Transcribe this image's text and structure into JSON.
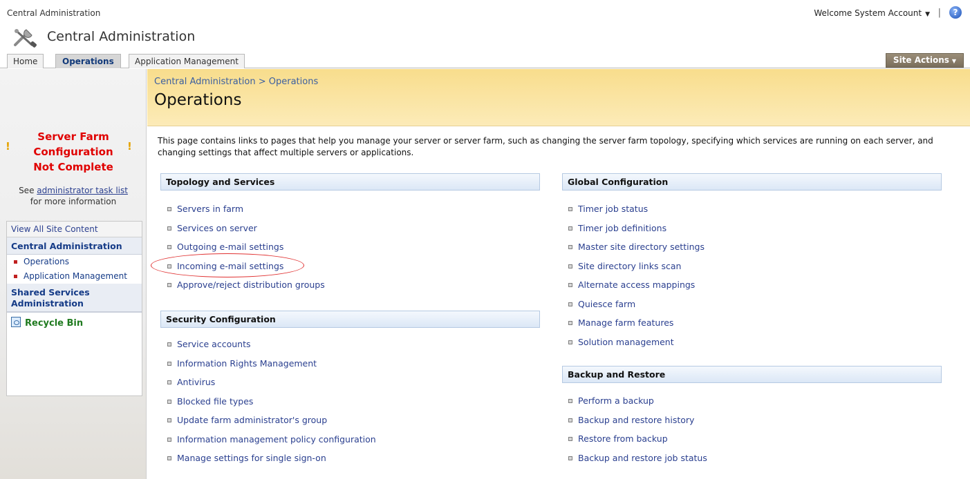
{
  "topbar": {
    "site_name": "Central Administration",
    "welcome": "Welcome System Account",
    "separator": "|"
  },
  "header": {
    "site_title": "Central Administration"
  },
  "tabs": [
    {
      "label": "Home"
    },
    {
      "label": "Operations",
      "selected": true
    },
    {
      "label": "Application Management"
    }
  ],
  "site_actions": "Site Actions",
  "sidebar": {
    "warning_lines": [
      "Server Farm",
      "Configuration",
      "Not Complete"
    ],
    "see_prefix": "See ",
    "task_list_link": "administrator task list",
    "see_suffix": "for more information",
    "quick_launch": {
      "view_all": "View All Site Content",
      "central_admin_heading": "Central Administration",
      "items": [
        {
          "label": "Operations"
        },
        {
          "label": "Application Management"
        }
      ],
      "shared_services_heading": "Shared Services Administration",
      "recycle_bin": "Recycle Bin"
    }
  },
  "main": {
    "breadcrumb": "Central Administration > Operations",
    "title": "Operations",
    "intro": "This page contains links to pages that help you manage your server or server farm, such as changing the server farm topology, specifying which services are running on each server, and changing settings that affect multiple servers or applications.",
    "sections": {
      "topology": {
        "heading": "Topology and Services",
        "links": [
          "Servers in farm",
          "Services on server",
          "Outgoing e-mail settings",
          "Incoming e-mail settings",
          "Approve/reject distribution groups"
        ]
      },
      "security": {
        "heading": "Security Configuration",
        "links": [
          "Service accounts",
          "Information Rights Management",
          "Antivirus",
          "Blocked file types",
          "Update farm administrator's group",
          "Information management policy configuration",
          "Manage settings for single sign-on"
        ]
      },
      "global": {
        "heading": "Global Configuration",
        "links": [
          "Timer job status",
          "Timer job definitions",
          "Master site directory settings",
          "Site directory links scan",
          "Alternate access mappings",
          "Quiesce farm",
          "Manage farm features",
          "Solution management"
        ]
      },
      "backup": {
        "heading": "Backup and Restore",
        "links": [
          "Perform a backup",
          "Backup and restore history",
          "Restore from backup",
          "Backup and restore job status"
        ]
      }
    },
    "highlighted_link": "Incoming e-mail settings",
    "highlight_color": "#e03030"
  }
}
